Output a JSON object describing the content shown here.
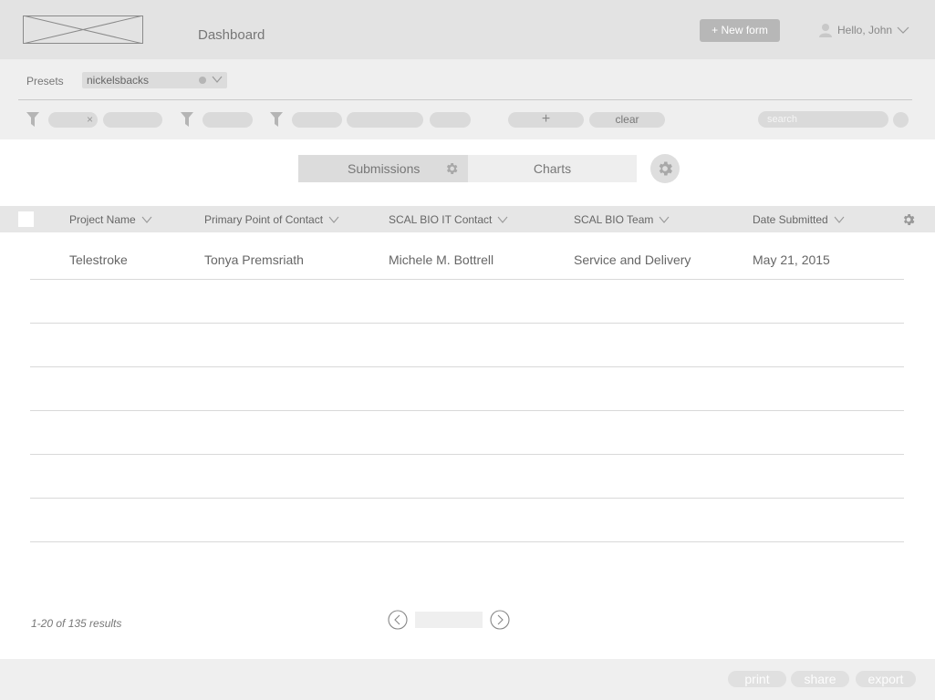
{
  "header": {
    "title": "Dashboard",
    "new_form_label": "+ New form",
    "user_greeting": "Hello, John",
    "icons": {
      "user": "user-icon",
      "chevron": "chevron-down-icon",
      "logo": "logo-placeholder"
    }
  },
  "presets": {
    "label": "Presets",
    "selected": "nickelsbacks"
  },
  "filters": {
    "clear_label": "clear",
    "add_label": "+",
    "search_placeholder": "search"
  },
  "tabs": [
    {
      "label": "Submissions",
      "active": true
    },
    {
      "label": "Charts",
      "active": false
    }
  ],
  "table": {
    "columns": [
      "Project Name",
      "Primary Point of Contact",
      "SCAL BIO IT Contact",
      "SCAL BIO Team",
      "Date Submitted"
    ],
    "rows": [
      [
        "Telestroke",
        "Tonya Premsriath",
        "Michele M. Bottrell",
        "Service and Delivery",
        "May 21, 2015"
      ]
    ]
  },
  "pagination": {
    "results_text": "1-20 of 135 results"
  },
  "footer": {
    "print_label": "print",
    "share_label": "share",
    "export_label": "export"
  },
  "colors": {
    "header_bg": "#e3e3e3",
    "toolbar_bg": "#efefef",
    "accent_gray": "#b7b7b7"
  }
}
